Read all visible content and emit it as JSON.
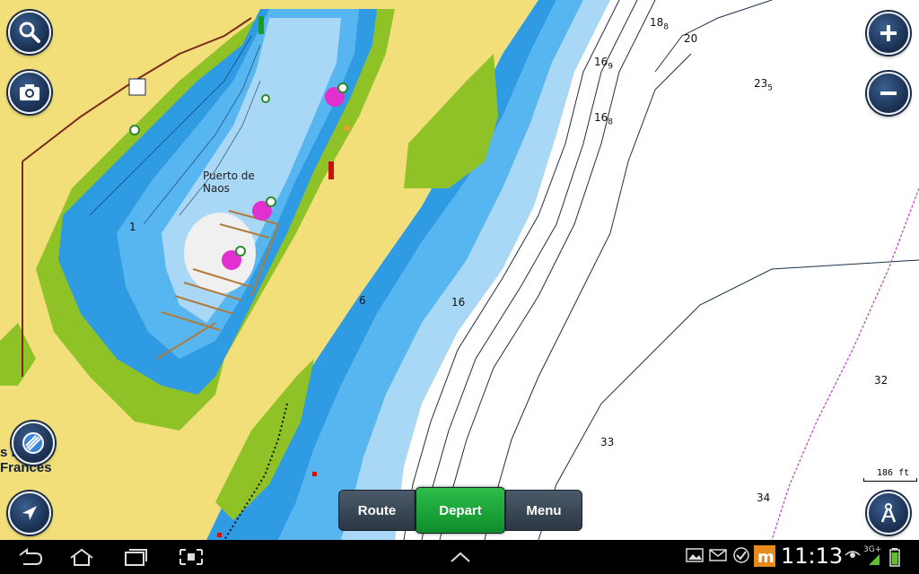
{
  "map": {
    "place_name": "Puerto de Naos",
    "partial_place_lines": [
      "s         l",
      "Francés"
    ],
    "depth_labels": [
      {
        "main": "18",
        "sub": "8"
      },
      {
        "main": "20",
        "sub": ""
      },
      {
        "main": "16",
        "sub": "9"
      },
      {
        "main": "23",
        "sub": "5"
      },
      {
        "main": "16",
        "sub": "8"
      },
      {
        "main": "1",
        "sub": ""
      },
      {
        "main": "6",
        "sub": ""
      },
      {
        "main": "16",
        "sub": ""
      },
      {
        "main": "32",
        "sub": ""
      },
      {
        "main": "33",
        "sub": ""
      },
      {
        "main": "34",
        "sub": ""
      }
    ],
    "scale_label": "186 ft",
    "colors": {
      "land": "#f3df7a",
      "shallow_green": "#8fc227",
      "deep_blue": "#2f9be2",
      "mid_blue": "#57b5f0",
      "light_blue": "#a9d8f6",
      "open_water": "#ffffff",
      "route_line": "#cc33cc"
    }
  },
  "controls": {
    "left": [
      {
        "name": "search-button",
        "icon": "magnifier-icon"
      },
      {
        "name": "camera-button",
        "icon": "camera-icon"
      },
      {
        "name": "layers-button",
        "icon": "layers-icon"
      },
      {
        "name": "navigate-button",
        "icon": "arrow-icon"
      }
    ],
    "right": [
      {
        "name": "zoom-in-button",
        "icon": "plus-icon"
      },
      {
        "name": "zoom-out-button",
        "icon": "minus-icon"
      },
      {
        "name": "compass-button",
        "icon": "compass-icon"
      }
    ]
  },
  "bottom_bar": {
    "route": "Route",
    "depart": "Depart",
    "menu": "Menu"
  },
  "system_bar": {
    "time": "11:13",
    "network": "3G+"
  }
}
